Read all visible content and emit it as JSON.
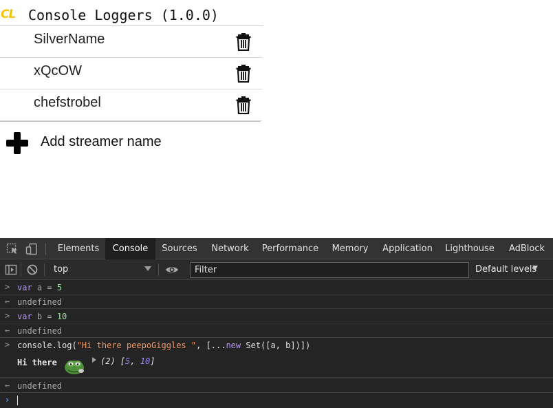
{
  "popup": {
    "logo": "CL",
    "title": "Console Loggers (1.0.0)",
    "streamers": [
      "SilverName",
      "xQcOW",
      "chefstrobel"
    ],
    "add_label": "Add streamer name"
  },
  "devtools": {
    "tabs": [
      "Elements",
      "Console",
      "Sources",
      "Network",
      "Performance",
      "Memory",
      "Application",
      "Lighthouse",
      "AdBlock"
    ],
    "active_tab": "Console",
    "context": "top",
    "filter_placeholder": "Filter",
    "levels": "Default levels",
    "console": {
      "l1": {
        "kw": "var",
        "rest": " a = ",
        "num": "5"
      },
      "r1": "undefined",
      "l2": {
        "kw": "var",
        "rest": " b = ",
        "num": "10"
      },
      "r2": "undefined",
      "l3": {
        "p1": "console.log(",
        "str": "\"Hi there peepoGiggles \"",
        "p2": ", [...",
        "kw": "new",
        "p3": " Set([a, b])])"
      },
      "out": {
        "text": "Hi there",
        "meta": "(2) [",
        "v1": "5",
        "sep": ", ",
        "v2": "10",
        "end": "]"
      },
      "r3": "undefined"
    }
  },
  "colors": {
    "logo": "#f5c400",
    "devtools_bg": "#242424",
    "tabbar_bg": "#333333",
    "keyword": "#b69af5",
    "number": "#9fe2a6",
    "string": "#f29766"
  }
}
